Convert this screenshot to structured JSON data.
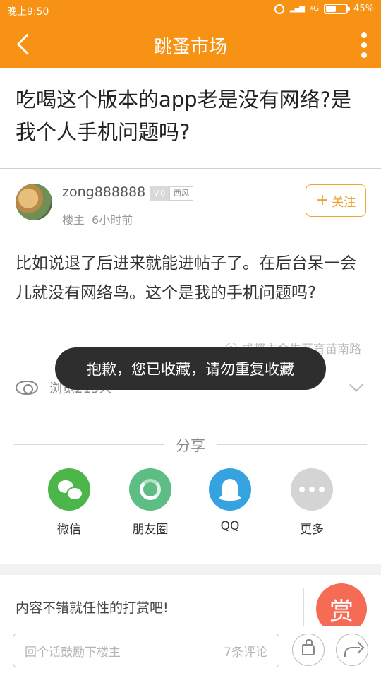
{
  "status_bar": {
    "time": "晚上9:50",
    "network": "4G",
    "battery_text": "45%",
    "battery_level": 0.45,
    "accent_color": "#f79214"
  },
  "nav": {
    "title": "跳蚤市场"
  },
  "post": {
    "title": "吃喝这个版本的app老是没有网络?是我个人手机问题吗?",
    "body": "比如说退了后进来就能进帖子了。在后台呆一会儿就没有网络鸟。这个是我的手机问题吗?",
    "location": "成都市金牛区育苗南路",
    "views": "浏览215人"
  },
  "author": {
    "name": "zong888888",
    "level": "V.0",
    "group": "西风",
    "role": "楼主",
    "time": "6小时前",
    "follow_label": "关注"
  },
  "toast": {
    "message": "抱歉，您已收藏，请勿重复收藏"
  },
  "share": {
    "title": "分享",
    "items": [
      {
        "label": "微信",
        "color": "#4cb64a",
        "icon": "wechat-icon"
      },
      {
        "label": "朋友圈",
        "color": "#5ebd84",
        "icon": "moments-icon"
      },
      {
        "label": "QQ",
        "color": "#36a2e0",
        "icon": "qq-icon"
      },
      {
        "label": "更多",
        "color": "#d4d4d4",
        "icon": "more-icon"
      }
    ]
  },
  "reward": {
    "prompt": "内容不错就任性的打赏吧!",
    "button_label": "赏"
  },
  "bottom_bar": {
    "comment_placeholder": "回个话鼓励下楼主",
    "comment_count": "7条评论"
  }
}
